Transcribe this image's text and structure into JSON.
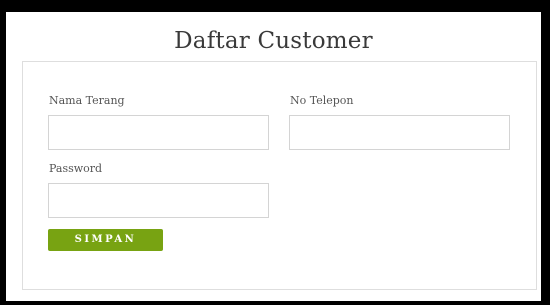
{
  "page": {
    "title": "Daftar Customer"
  },
  "form": {
    "name_label": "Nama Terang",
    "name_value": "",
    "phone_label": "No Telepon",
    "phone_value": "",
    "password_label": "Password",
    "password_value": "",
    "submit_label": "SIMPAN"
  },
  "colors": {
    "accent": "#78a312",
    "frame": "#000000",
    "card_border": "#dedede"
  }
}
